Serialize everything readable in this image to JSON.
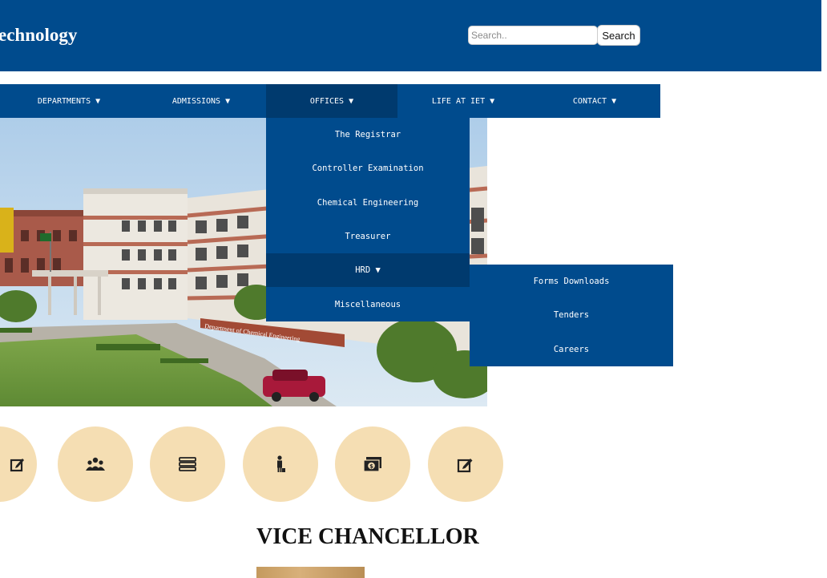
{
  "header": {
    "site_title": "echnology",
    "search": {
      "placeholder": "Search..",
      "value": "",
      "button_label": "Search"
    },
    "background": "#004b8d"
  },
  "nav": {
    "items": [
      {
        "label": "DEPARTMENTS ▼"
      },
      {
        "label": "ADMISSIONS ▼"
      },
      {
        "label": "OFFICES ▼",
        "active": true
      },
      {
        "label": "LIFE AT IET ▼"
      },
      {
        "label": "CONTACT ▼"
      }
    ]
  },
  "offices_dropdown": {
    "items": [
      {
        "label": "The Registrar"
      },
      {
        "label": "Controller Examination"
      },
      {
        "label": "Chemical Engineering"
      },
      {
        "label": "Treasurer"
      },
      {
        "label": "HRD ▼",
        "active": true
      },
      {
        "label": "Miscellaneous"
      }
    ]
  },
  "hrd_submenu": {
    "items": [
      {
        "label": "Forms Downloads"
      },
      {
        "label": "Tenders"
      },
      {
        "label": "Careers"
      }
    ]
  },
  "hero": {
    "building_sign": "Department of Chemical Engineering"
  },
  "quick_links": {
    "icons": [
      "edit-icon",
      "users-icon",
      "books-icon",
      "person-icon",
      "money-icon",
      "edit-icon"
    ],
    "circle_color": "#f5deb3"
  },
  "vice_chancellor": {
    "heading": "VICE CHANCELLOR"
  },
  "colors": {
    "primary": "#004b8d",
    "active": "#003a6e",
    "accent": "#f5deb3"
  }
}
